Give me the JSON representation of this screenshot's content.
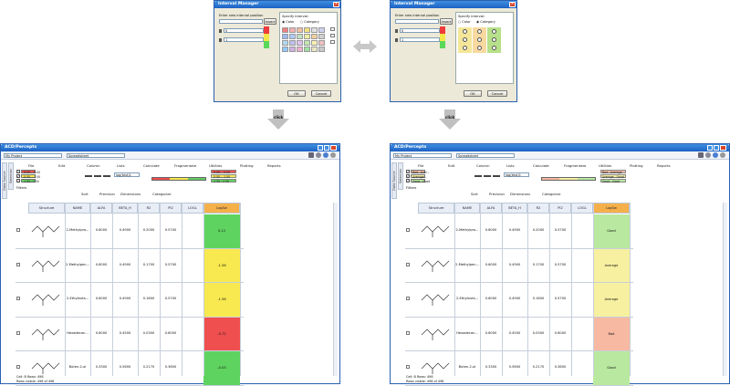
{
  "dialog": {
    "title": "Interval Manager",
    "enter_label": "Enter new interval position",
    "insert_label": "Insert",
    "specify_label": "Specify interval:",
    "color_label": "Color",
    "category_label": "Category",
    "field1": "0",
    "field2": "1",
    "ok": "OK",
    "cancel": "Cancel",
    "swatch_rows": [
      [
        "#f08080",
        "#f4b0b0",
        "#f0c0a0",
        "#f4e080",
        "#e0e0e0",
        "#d0d0f0"
      ],
      [
        "#a0b8f0",
        "#b0c8f8",
        "#c0e0c0",
        "#f0f0a0",
        "#f0d0a0",
        "#d0d0d0"
      ],
      [
        "#b0d8f0",
        "#c0c0f0",
        "#e0c0f0",
        "#c0e8b0",
        "#f8f0b0",
        "#f0c0c0"
      ],
      [
        "#90c8f8",
        "#d0b0e0",
        "#f0b0d0",
        "#a0e0a0",
        "#e8e8c0",
        "#c8c8c8"
      ]
    ],
    "category_cols": [
      "#f4e79a",
      "#f8d9a0",
      "#b7e08a"
    ]
  },
  "click_label": "click",
  "app": {
    "title": "ACD/Percepts",
    "project": "My Project",
    "view": "Spreadsheet",
    "menus": [
      "File",
      "Edit",
      "Column",
      "Lists",
      "Calculate",
      "Fragmentate",
      "Utilities",
      "Plotting",
      "Reports"
    ],
    "subtoolbar": [
      "Sort",
      "Precision",
      "Dimensions",
      "Categorize"
    ],
    "filters_label": "Filters",
    "data_source_tab": "Data Source",
    "selection_tab": "Selection",
    "log_combo": "log(test)1",
    "headers": [
      "Structure",
      "NAME",
      "ALFA",
      "BETA_H",
      "R2",
      "PI2",
      "LOGL",
      "LogSw"
    ],
    "rows": [
      {
        "name": "2-Methylpro...",
        "alfa": "0.6000",
        "beta": "0.4900",
        "r2": "0.2000",
        "pi2": "0.5700",
        "val": "0.12",
        "cat": "Good"
      },
      {
        "name": "2-Methylpen...",
        "alfa": "0.6000",
        "beta": "0.4900",
        "r2": "0.1700",
        "pi2": "0.5700",
        "val": "-1.56",
        "cat": "Average"
      },
      {
        "name": "2-Ethylbuta...",
        "alfa": "0.6000",
        "beta": "0.4900",
        "r2": "0.1800",
        "pi2": "0.5700",
        "val": "-1.56",
        "cat": "Average"
      },
      {
        "name": "Hexadecan...",
        "alfa": "0.6000",
        "beta": "0.4500",
        "r2": "0.0300",
        "pi2": "0.6000",
        "val": "-5.72",
        "cat": "Bad"
      },
      {
        "name": "Buten-2-ol",
        "alfa": "0.3300",
        "beta": "0.5600",
        "r2": "0.2170",
        "pi2": "0.3600",
        "val": "-0.03",
        "cat": "Good"
      }
    ],
    "left_legend": [
      {
        "label": "-9.00...-5.00",
        "color": "#ef4f4f"
      },
      {
        "label": "-5.00...-1.50",
        "color": "#f7e94f"
      },
      {
        "label": "-1.50...1.50",
        "color": "#62d062"
      }
    ],
    "right_legend": [
      {
        "label": "Bad...Aver...",
        "color": "#f7b9a2"
      },
      {
        "label": "Average...",
        "color": "#f7f0a0"
      },
      {
        "label": "Good...Good",
        "color": "#b9e9a0"
      }
    ],
    "left_scale": [
      "-9.00...-5.00",
      "-5.00...-1.50",
      "-1.50...1.50"
    ],
    "right_scale": [
      "Bad...Average",
      "Average...Good",
      "Good...Good"
    ],
    "status1": "Cell: B  Rows: 498",
    "status2": "Rows visible: 498 of 498"
  },
  "colors": {
    "left_cells": [
      "#5fd35f",
      "#f7e94f",
      "#f7e94f",
      "#ef4f4f",
      "#5fd35f"
    ],
    "right_cells": [
      "#b9e9a0",
      "#f7f0a0",
      "#f7f0a0",
      "#f7b9a2",
      "#b9e9a0"
    ],
    "log_header": "#f5b04a",
    "accent": "#1d62c4"
  }
}
